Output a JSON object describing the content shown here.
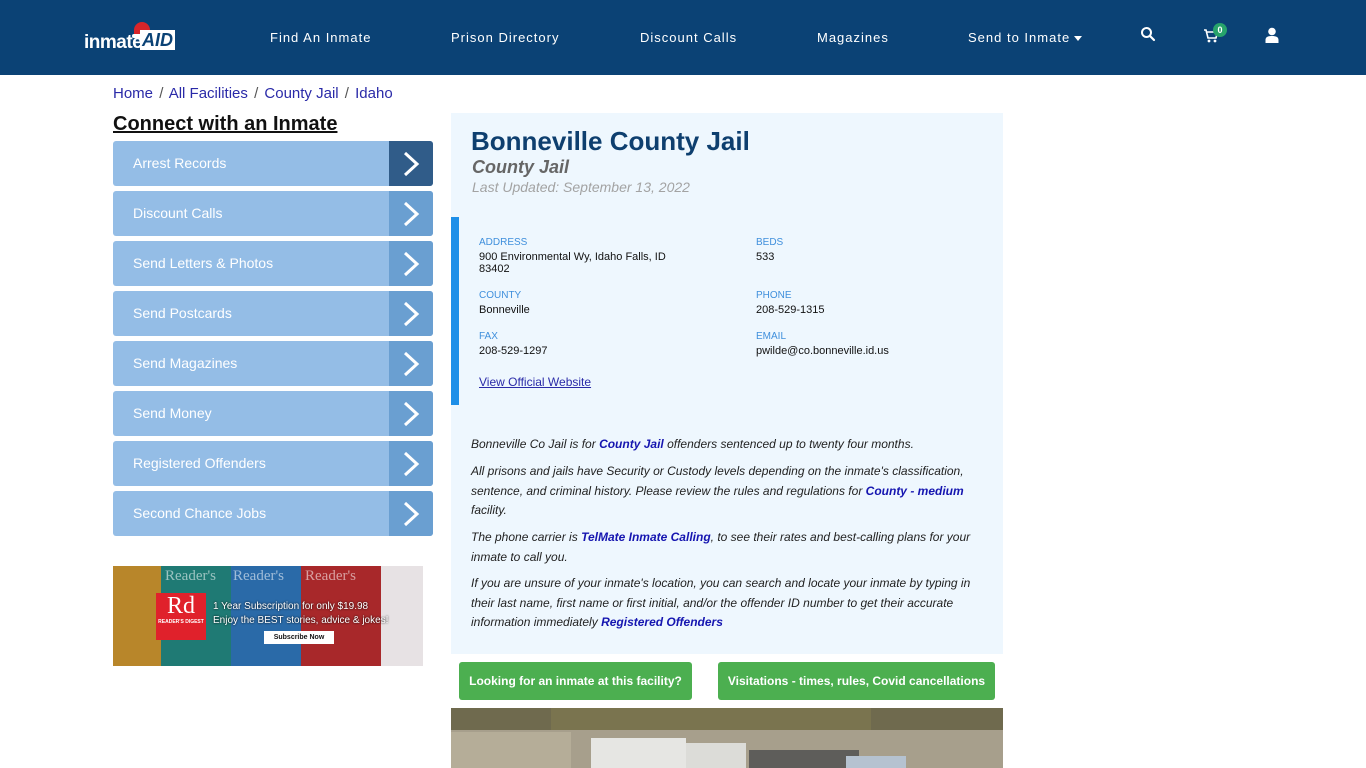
{
  "header": {
    "logo": {
      "word": "inmate",
      "aid": "AID"
    },
    "nav": [
      {
        "label": "Find An Inmate"
      },
      {
        "label": "Prison Directory"
      },
      {
        "label": "Discount Calls"
      },
      {
        "label": "Magazines"
      },
      {
        "label": "Send to Inmate",
        "has_dropdown": true
      }
    ],
    "cart_count": "0",
    "icons": [
      "search-icon",
      "cart-icon",
      "user-icon"
    ]
  },
  "breadcrumb": {
    "items": [
      "Home",
      "All Facilities",
      "County Jail",
      "Idaho"
    ],
    "separator": "/"
  },
  "sidebar": {
    "title": "Connect with an Inmate",
    "items": [
      {
        "label": "Arrest Records"
      },
      {
        "label": "Discount Calls"
      },
      {
        "label": "Send Letters & Photos"
      },
      {
        "label": "Send Postcards"
      },
      {
        "label": "Send Magazines"
      },
      {
        "label": "Send Money"
      },
      {
        "label": "Registered Offenders"
      },
      {
        "label": "Second Chance Jobs"
      }
    ],
    "ad": {
      "brand_big": "Rd",
      "brand_small": "READER'S DIGEST",
      "masthead": "Reader's",
      "line1": "1 Year Subscription for only $19.98",
      "line2": "Enjoy the BEST stories, advice & jokes!",
      "button": "Subscribe Now"
    }
  },
  "facility": {
    "name": "Bonneville County Jail",
    "type": "County Jail",
    "last_updated": "Last Updated: September 13, 2022",
    "info": {
      "address_label": "ADDRESS",
      "address_line1": "900 Environmental Wy, Idaho Falls, ID",
      "address_line2": "83402",
      "beds_label": "BEDS",
      "beds": "533",
      "county_label": "COUNTY",
      "county": "Bonneville",
      "phone_label": "PHONE",
      "phone": "208-529-1315",
      "fax_label": "FAX",
      "fax": "208-529-1297",
      "email_label": "EMAIL",
      "email": "pwilde@co.bonneville.id.us",
      "website_link": "View Official Website"
    },
    "description": {
      "p1_a": "Bonneville Co Jail is for ",
      "p1_link": "County Jail",
      "p1_b": " offenders sentenced up to twenty four months.",
      "p2_a": "All prisons and jails have Security or Custody levels depending on the inmate's classification, sentence, and criminal history. Please review the rules and regulations for ",
      "p2_link": "County - medium",
      "p2_b": " facility.",
      "p3_a": "The phone carrier is ",
      "p3_link": "TelMate Inmate Calling",
      "p3_b": ", to see their rates and best-calling plans for your inmate to call you.",
      "p4_a": "If you are unsure of your inmate's location, you can search and locate your inmate by typing in their last name, first name or first initial, and/or the offender ID number to get their accurate information immediately ",
      "p4_link": "Registered Offenders"
    },
    "buttons": {
      "find_inmate": "Looking for an inmate at this facility?",
      "visitations": "Visitations - times, rules, Covid cancellations"
    }
  },
  "colors": {
    "header_bg": "#0b4275",
    "sidebar_item": "#94bde6",
    "sidebar_arrow": "#6a9fd1",
    "sidebar_arrow_active": "#305c89",
    "card_bg": "#eef7fe",
    "info_accent": "#1e8fe8",
    "green_button": "#4caf50",
    "title": "#0e3f6f"
  }
}
